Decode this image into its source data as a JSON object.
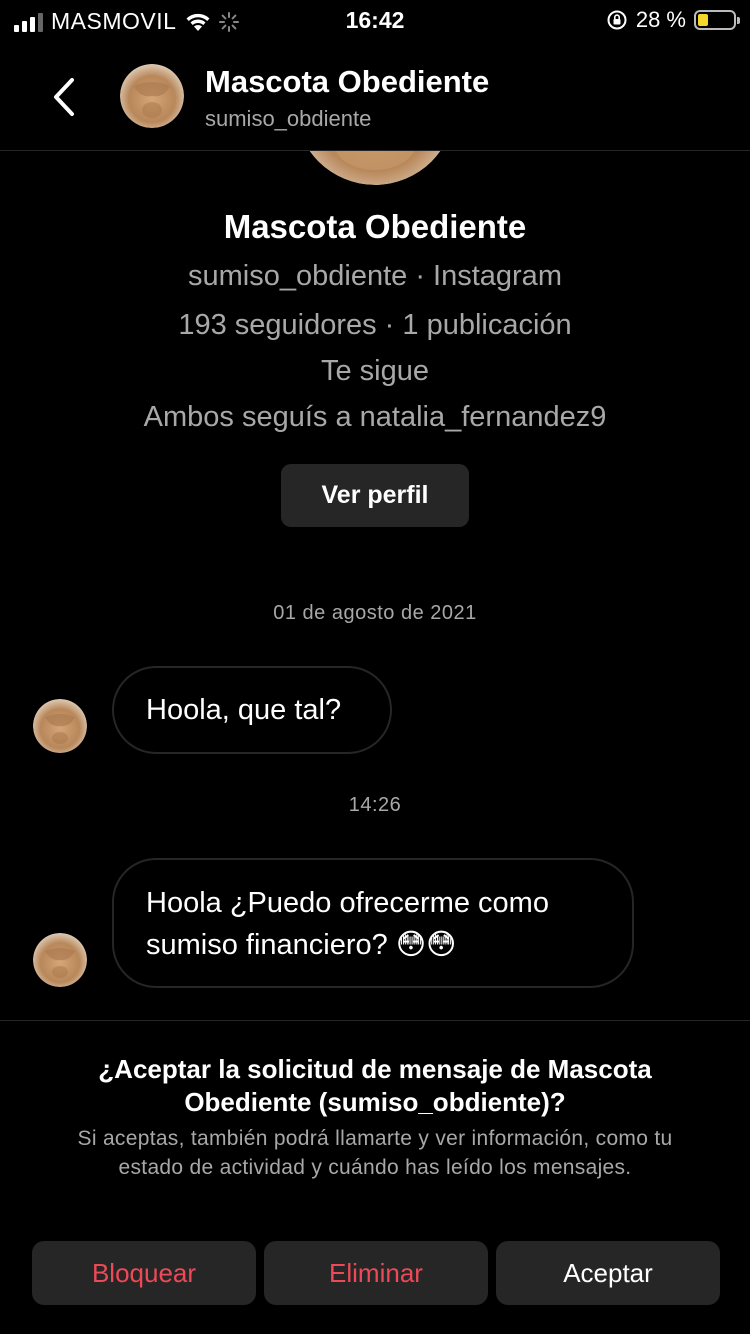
{
  "status_bar": {
    "carrier": "MASMOVIL",
    "time": "16:42",
    "battery_text": "28 %",
    "battery_level": 0.28,
    "battery_color": "#f6d62b"
  },
  "header": {
    "back_icon": "chevron-left-icon",
    "name": "Mascota Obediente",
    "username": "sumiso_obdiente"
  },
  "profile": {
    "name": "Mascota Obediente",
    "handle_line": "sumiso_obdiente · Instagram",
    "stats_line": "193 seguidores · 1 publicación",
    "follows_line": "Te sigue",
    "mutual_line": "Ambos seguís a natalia_fernandez9",
    "view_profile_label": "Ver perfil"
  },
  "conversation": {
    "date_header": "01 de agosto de 2021",
    "time_header": "14:26",
    "messages": [
      {
        "text": "Hoola, que tal?"
      },
      {
        "text": "Hoola ¿Puedo ofrecerme como sumiso financiero? 😳😳"
      }
    ]
  },
  "request": {
    "title": "¿Aceptar la solicitud de mensaje de Mascota Obediente (sumiso_obdiente)?",
    "body": "Si aceptas, también podrá llamarte y ver información, como tu estado de actividad y cuándo has leído los mensajes.",
    "block_label": "Bloquear",
    "delete_label": "Eliminar",
    "accept_label": "Aceptar",
    "danger_color": "#ed4956"
  }
}
